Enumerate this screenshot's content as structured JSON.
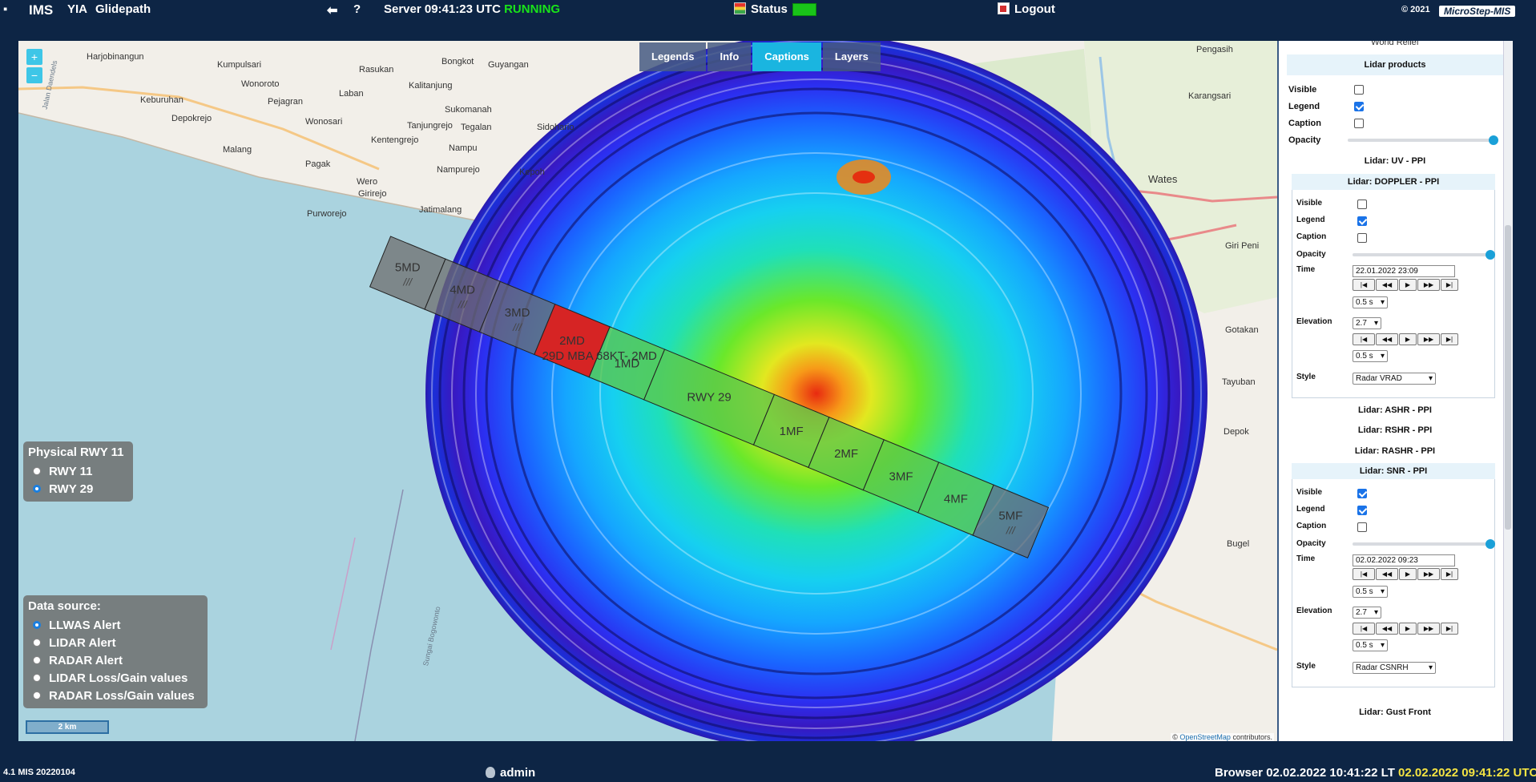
{
  "topbar": {
    "app_name": "IMS",
    "airport": "YIA",
    "module": "Glidepath",
    "back_icon": "arrow-left-icon",
    "help_label": "?",
    "server_label": "Server 09:41:23 UTC",
    "server_state": "RUNNING",
    "status_label": "Status",
    "logout_label": "Logout",
    "copyright": "© 2021",
    "brand": "MicroStep-MIS"
  },
  "map": {
    "zoom_in": "+",
    "zoom_out": "−",
    "tabs": [
      {
        "label": "Legends",
        "active": false
      },
      {
        "label": "Info",
        "active": false
      },
      {
        "label": "Captions",
        "active": true
      },
      {
        "label": "Layers",
        "active": false
      }
    ],
    "places": [
      "Harjobinangun",
      "Kumpulsari",
      "Wonoroto",
      "Keburuhan",
      "Pejagran",
      "Depokrejo",
      "Wonosari",
      "Malang",
      "Pagak",
      "Wero",
      "Girirejo",
      "Purworejo",
      "Kentengrejo",
      "Jatimalang",
      "Rasukan",
      "Laban",
      "Bongkot",
      "Kalitanjung",
      "Sukomanah",
      "Tanjungrejo",
      "Tegalan",
      "Nampu",
      "Nampurejo",
      "Guyangan",
      "Sidohario",
      "Kepoh",
      "Wates",
      "Karangsari",
      "Pengasih",
      "Giri Peni",
      "Gotakan",
      "Tayuban",
      "Depok",
      "Bugel",
      "Jalan Daendels",
      "Sungai Bogowonto"
    ],
    "runway_segments": [
      {
        "label": "5MD",
        "sub": "///",
        "alert": "none"
      },
      {
        "label": "4MD",
        "sub": "///",
        "alert": "none"
      },
      {
        "label": "3MD",
        "sub": "///",
        "alert": "none"
      },
      {
        "label": "2MD",
        "sub": "",
        "alert": "red"
      },
      {
        "label": "1MD",
        "sub": "",
        "alert": "green"
      },
      {
        "label": "RWY 29",
        "sub": "",
        "alert": "green"
      },
      {
        "label": "1MF",
        "sub": "",
        "alert": "green"
      },
      {
        "label": "2MF",
        "sub": "",
        "alert": "green"
      },
      {
        "label": "3MF",
        "sub": "",
        "alert": "green"
      },
      {
        "label": "4MF",
        "sub": "",
        "alert": "green"
      },
      {
        "label": "5MF",
        "sub": "///",
        "alert": "none"
      }
    ],
    "runway_alert_caption": "29D MBA 68KT- 2MD",
    "physical_rwy": {
      "title": "Physical RWY 11",
      "options": [
        {
          "label": "RWY 11",
          "checked": false
        },
        {
          "label": "RWY 29",
          "checked": true
        }
      ]
    },
    "data_source": {
      "title": "Data source:",
      "options": [
        {
          "label": "LLWAS Alert",
          "checked": true
        },
        {
          "label": "LIDAR Alert",
          "checked": false
        },
        {
          "label": "RADAR Alert",
          "checked": false
        },
        {
          "label": "LIDAR Loss/Gain values",
          "checked": false
        },
        {
          "label": "RADAR Loss/Gain values",
          "checked": false
        }
      ]
    },
    "scale": "2 km",
    "credit_prefix": "©",
    "credit_link": "OpenStreetMap",
    "credit_suffix": "contributors."
  },
  "panel": {
    "top_cut": "World Relief",
    "section_title": "Lidar products",
    "visible_label": "Visible",
    "legend_label": "Legend",
    "caption_label": "Caption",
    "opacity_label": "Opacity",
    "time_label": "Time",
    "elevation_label": "Elevation",
    "style_label": "Style",
    "products": {
      "visible": false,
      "legend": true,
      "caption": false
    },
    "uv_ppi": "Lidar: UV - PPI",
    "doppler": {
      "title": "Lidar: DOPPLER - PPI",
      "visible": false,
      "legend": true,
      "caption": false,
      "time": "22.01.2022 23:09",
      "speed1": "0.5 s",
      "elevation": "2.7",
      "speed2": "0.5 s",
      "style": "Radar VRAD"
    },
    "ashr_ppi": "Lidar: ASHR - PPI",
    "rshr_ppi": "Lidar: RSHR - PPI",
    "rashr_ppi": "Lidar: RASHR - PPI",
    "snr": {
      "title": "Lidar: SNR - PPI",
      "visible": true,
      "legend": true,
      "caption": false,
      "time": "02.02.2022 09:23",
      "speed1": "0.5 s",
      "elevation": "2.7",
      "speed2": "0.5 s",
      "style": "Radar CSNRH"
    },
    "gust_front": "Lidar: Gust Front",
    "player_buttons": [
      "|◀",
      "◀◀",
      "▶",
      "▶▶",
      "▶|"
    ]
  },
  "bottombar": {
    "version": "4.1 MIS 20220104",
    "user": "admin",
    "browser_label": "Browser 02.02.2022 10:41:22 LT",
    "utc_time": "02.02.2022 09:41:22 UTC"
  },
  "colors": {
    "background": "#0d2545",
    "tab_active": "#1ab5e0",
    "alert_red": "#d62424",
    "alert_green": "#5cc84a",
    "running": "#19e419"
  }
}
